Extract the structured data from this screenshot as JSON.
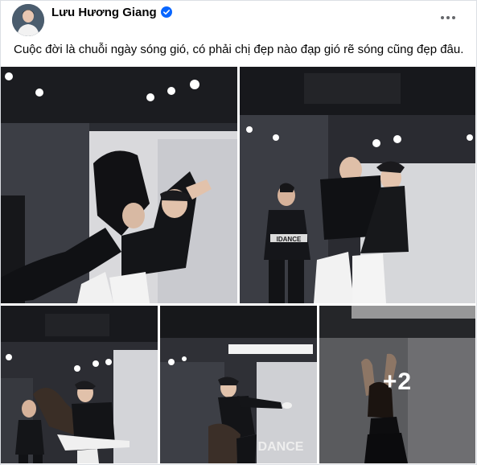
{
  "post": {
    "author": "Lưu Hương Giang",
    "verified_icon": "verified-badge-icon",
    "menu_icon": "more-horizontal-icon",
    "caption": "Cuộc đời là chuỗi ngày sóng gió, có phải chị đẹp nào đạp gió rẽ sóng cũng đẹp đâu.",
    "photos": [
      {
        "name": "photo-1",
        "jersey": ""
      },
      {
        "name": "photo-2",
        "jersey": "IDANCE"
      },
      {
        "name": "photo-3",
        "jersey": ""
      },
      {
        "name": "photo-4",
        "wall_text": "DANCE"
      },
      {
        "name": "photo-5",
        "more_count": "+2"
      }
    ]
  },
  "colors": {
    "accent": "#0866ff",
    "text": "#050505"
  }
}
